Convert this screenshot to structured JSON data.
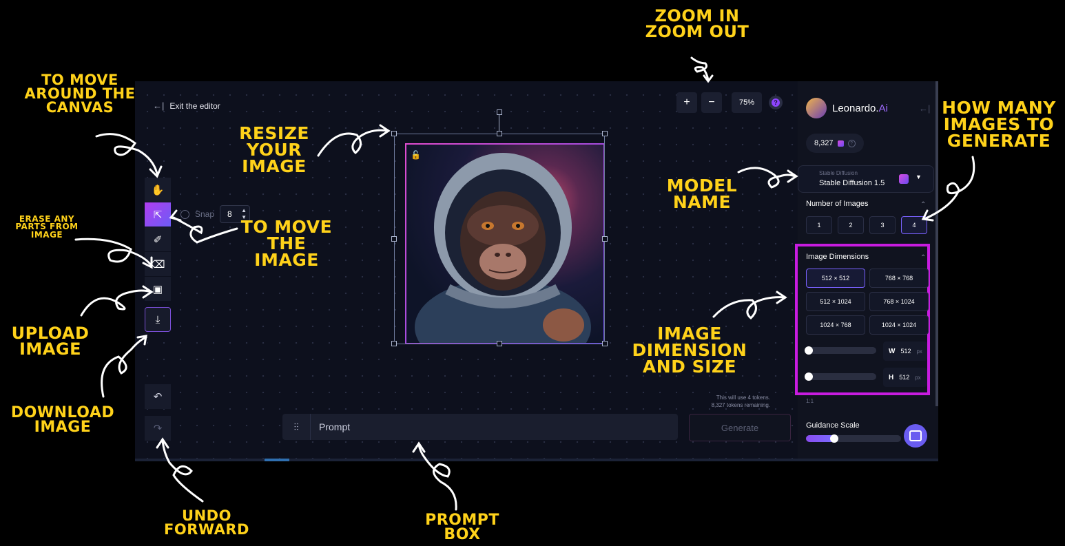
{
  "editor": {
    "exit_label": "Exit the editor",
    "exit_icon": "arrow-left-bar-icon",
    "zoom_in": "+",
    "zoom_out": "−",
    "zoom_level": "75%",
    "help": "?",
    "snap_label": "Snap",
    "snap_value": "8",
    "prompt_placeholder": "Prompt",
    "generate_label": "Generate",
    "tokens_line1": "This will use 4 tokens.",
    "tokens_line2": "8,327 tokens remaining."
  },
  "toolbar": {
    "tools": [
      "hand-icon",
      "select-icon",
      "brush-icon",
      "eraser-icon",
      "image-icon",
      "download-icon"
    ],
    "undo_icon": "undo-icon",
    "redo_icon": "redo-icon"
  },
  "panel": {
    "brand": "Leonardo.",
    "brand_accent": "Ai",
    "credits": "8,327",
    "model_sub": "Stable Diffusion",
    "model_name": "Stable Diffusion 1.5",
    "num_images_title": "Number of Images",
    "num_images": [
      "1",
      "2",
      "3",
      "4"
    ],
    "num_images_selected": "4",
    "dims_title": "Image Dimensions",
    "dims": [
      "512 × 512",
      "768 × 768",
      "512 × 1024",
      "768 × 1024",
      "1024 × 768",
      "1024 × 1024"
    ],
    "dims_selected": "512 × 512",
    "width_label": "W",
    "width_value": "512",
    "height_label": "H",
    "height_value": "512",
    "unit": "px",
    "ratio": "1:1",
    "guidance_title": "Guidance Scale",
    "guidance_level": 0.3
  },
  "annotations": {
    "move_canvas": "TO MOVE\nAROUND THE\nCANVAS",
    "erase": "ERASE ANY\nPARTS FROM\nIMAGE",
    "upload": "UPLOAD\nIMAGE",
    "download": "DOWNLOAD\nIMAGE",
    "undo": "UNDO\nFORWARD",
    "resize": "RESIZE\nYOUR\nIMAGE",
    "move_image": "TO MOVE\nTHE\nIMAGE",
    "prompt": "PROMPT\nBOX",
    "zoom": "ZOOM IN\nZOOM OUT",
    "model": "MODEL\nNAME",
    "how_many": "HOW MANY\nIMAGES TO\nGENERATE",
    "dimension": "IMAGE\nDIMENSION\nAND SIZE"
  },
  "colors": {
    "accent": "#8d44ff",
    "highlight": "#c81ce0",
    "annotation": "#ffd21a"
  }
}
